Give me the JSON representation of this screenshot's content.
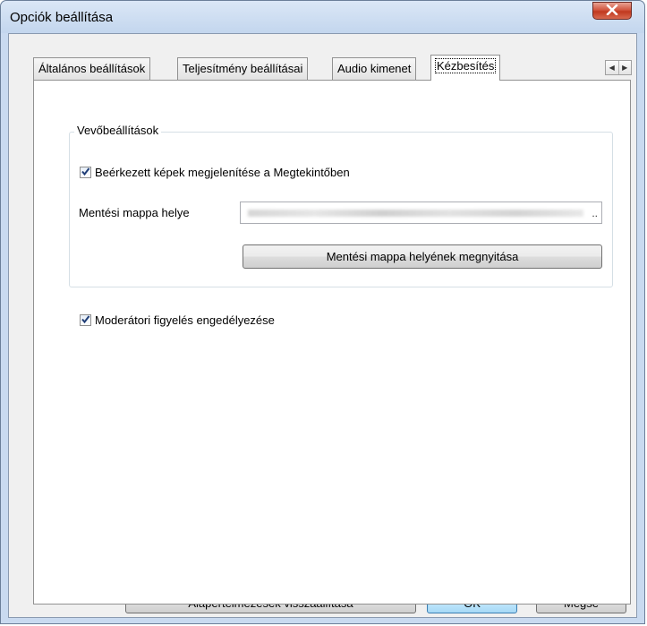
{
  "window": {
    "title": "Opciók beállítása",
    "close_icon": "close-x-icon"
  },
  "tabs": [
    {
      "label": "Általános beállítások",
      "active": false
    },
    {
      "label": "Teljesítmény beállításai",
      "active": false
    },
    {
      "label": "Audio kimenet",
      "active": false
    },
    {
      "label": "Kézbesítés",
      "active": true
    }
  ],
  "tab_scroll": {
    "left_icon": "arrow-left-icon",
    "right_icon": "arrow-right-icon"
  },
  "receiver_group": {
    "title": "Vevőbeállítások",
    "show_images_label": "Beérkezett képek megjelenítése a Megtekintőben",
    "show_images_checked": true,
    "save_folder_label": "Mentési mappa helye",
    "save_folder_value_ellipsis": "..",
    "open_folder_button": "Mentési mappa helyének megnyitása"
  },
  "moderator": {
    "label": "Moderátori figyelés engedélyezése",
    "checked": true
  },
  "footer": {
    "reset_button": "Alapértelmezések visszaállítása",
    "ok_button": "OK",
    "cancel_button": "Mégse"
  },
  "colors": {
    "close_button": "#c9442c",
    "default_button_border": "#3c7fb1",
    "check_mark": "#1f3d76"
  }
}
